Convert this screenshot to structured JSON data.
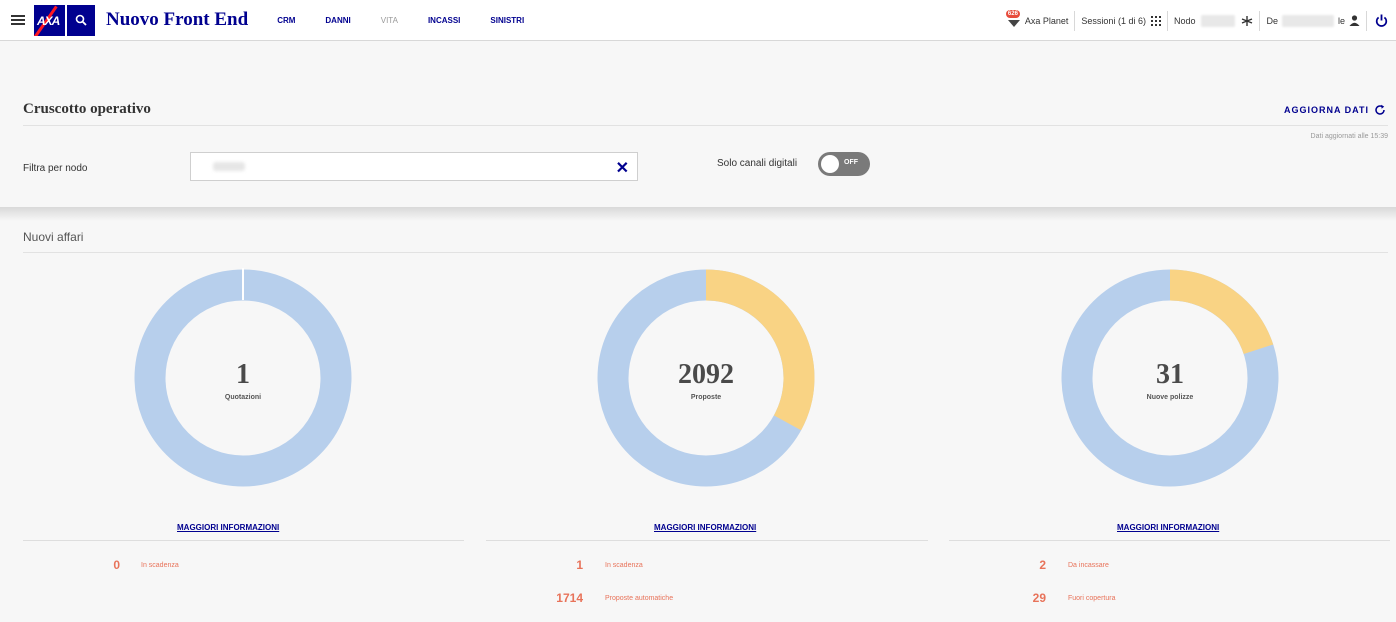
{
  "topbar": {
    "app_title": "Nuovo Front End",
    "logo_text": "AXA",
    "nav": [
      {
        "label": "CRM",
        "enabled": true
      },
      {
        "label": "DANNI",
        "enabled": true
      },
      {
        "label": "VITA",
        "enabled": false
      },
      {
        "label": "INCASSI",
        "enabled": true
      },
      {
        "label": "SINISTRI",
        "enabled": true
      }
    ],
    "planet_badge": "626",
    "planet_label": "Axa Planet",
    "sessions_label": "Sessioni (1 di 6)",
    "node_label": "Nodo",
    "user_prefix": "De",
    "user_suffix": "le"
  },
  "header": {
    "title": "Cruscotto operativo",
    "refresh_label": "AGGIORNA DATI",
    "updated_at": "Dati aggiornati alle 15:39"
  },
  "filters": {
    "node_label": "Filtra per nodo",
    "clear_icon": "✕",
    "digital_label": "Solo canali digitali",
    "toggle_state": "OFF"
  },
  "section": {
    "title": "Nuovi affari"
  },
  "colors": {
    "primary": "#00008f",
    "donut_blue": "#b7cfec",
    "donut_yellow": "#f9d384",
    "stat_orange": "#e8735a"
  },
  "cards": [
    {
      "value": "1",
      "label": "Quotazioni",
      "yellow_fraction": 0,
      "more_info": "MAGGIORI INFORMAZIONI",
      "stats": [
        {
          "value": "0",
          "label": "In scadenza"
        }
      ]
    },
    {
      "value": "2092",
      "label": "Proposte",
      "yellow_fraction": 0.33,
      "more_info": "MAGGIORI INFORMAZIONI",
      "stats": [
        {
          "value": "1",
          "label": "In scadenza"
        },
        {
          "value": "1714",
          "label": "Proposte automatiche"
        }
      ]
    },
    {
      "value": "31",
      "label": "Nuove polizze",
      "yellow_fraction": 0.2,
      "more_info": "MAGGIORI INFORMAZIONI",
      "stats": [
        {
          "value": "2",
          "label": "Da incassare"
        },
        {
          "value": "29",
          "label": "Fuori copertura"
        }
      ]
    }
  ]
}
